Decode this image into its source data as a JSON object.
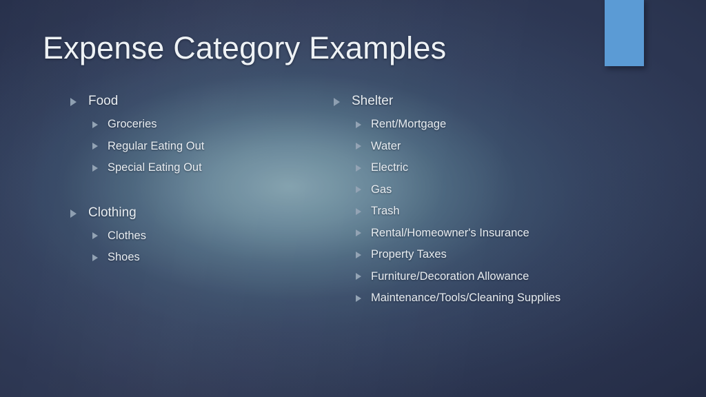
{
  "slide": {
    "title": "Expense Category Examples",
    "accent_color": "#5B9BD5",
    "text_color": "#E8EDF1",
    "bullet_color": "#8E9FB1",
    "bullet_glyph": "triangle-right"
  },
  "columns": {
    "left": [
      {
        "label": "Food",
        "children": [
          {
            "label": "Groceries"
          },
          {
            "label": "Regular Eating Out"
          },
          {
            "label": "Special Eating Out"
          }
        ]
      },
      {
        "label": "Clothing",
        "children": [
          {
            "label": "Clothes"
          },
          {
            "label": "Shoes"
          }
        ]
      }
    ],
    "right": [
      {
        "label": "Shelter",
        "children": [
          {
            "label": "Rent/Mortgage"
          },
          {
            "label": "Water"
          },
          {
            "label": "Electric"
          },
          {
            "label": "Gas"
          },
          {
            "label": "Trash"
          },
          {
            "label": "Rental/Homeowner's Insurance"
          },
          {
            "label": "Property Taxes"
          },
          {
            "label": "Furniture/Decoration Allowance"
          },
          {
            "label": "Maintenance/Tools/Cleaning Supplies"
          }
        ]
      }
    ]
  }
}
